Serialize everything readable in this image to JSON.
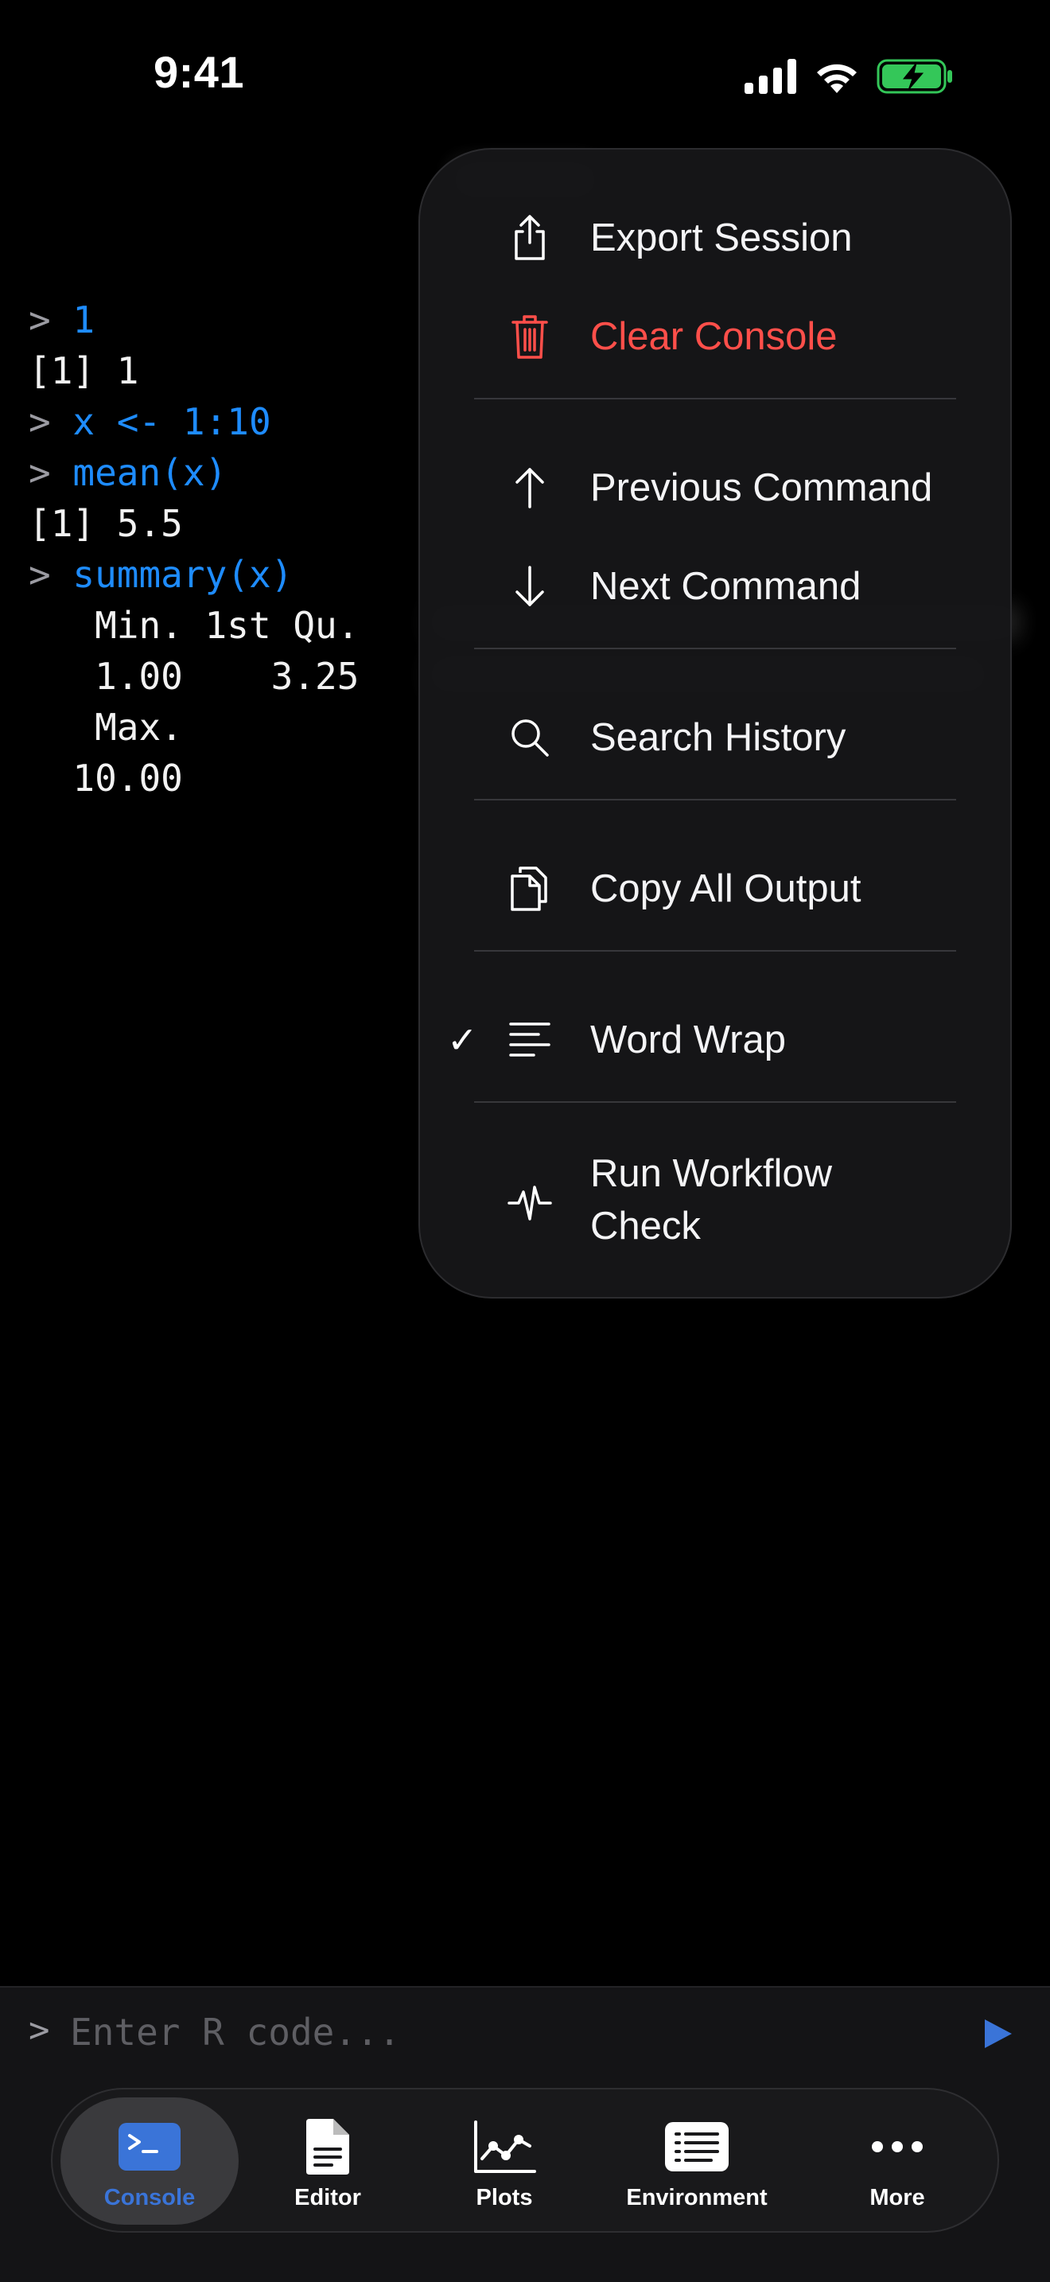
{
  "status": {
    "time": "9:41"
  },
  "console": {
    "lines": [
      {
        "type": "cmd",
        "prompt": ">",
        "text": "1"
      },
      {
        "type": "out",
        "text": "[1] 1"
      },
      {
        "type": "cmd",
        "prompt": ">",
        "text": "x <- 1:10"
      },
      {
        "type": "cmd",
        "prompt": ">",
        "text": "mean(x)"
      },
      {
        "type": "out",
        "text": "[1] 5.5"
      },
      {
        "type": "cmd",
        "prompt": ">",
        "text": "summary(x)"
      },
      {
        "type": "out",
        "text": "   Min. 1st Qu."
      },
      {
        "type": "out",
        "text": "   1.00    3.25"
      },
      {
        "type": "out",
        "text": "   Max."
      },
      {
        "type": "out",
        "text": "  10.00"
      }
    ]
  },
  "menu": {
    "items": [
      {
        "label": "Export Session",
        "icon": "share-icon"
      },
      {
        "label": "Clear Console",
        "icon": "trash-icon",
        "destructive": true
      },
      {
        "label": "Previous Command",
        "icon": "arrow-up-icon"
      },
      {
        "label": "Next Command",
        "icon": "arrow-down-icon"
      },
      {
        "label": "Search History",
        "icon": "search-icon"
      },
      {
        "label": "Copy All Output",
        "icon": "copy-icon"
      },
      {
        "label": "Word Wrap",
        "icon": "text-align-left-icon",
        "checked": true,
        "check": "✓"
      },
      {
        "label_line1": "Run Workflow",
        "label_line2": "Check",
        "icon": "waveform-icon"
      }
    ]
  },
  "input": {
    "prompt": ">",
    "placeholder": "Enter R code...",
    "value": ""
  },
  "tabs": [
    {
      "label": "Console",
      "icon": "terminal-icon",
      "active": true
    },
    {
      "label": "Editor",
      "icon": "document-icon"
    },
    {
      "label": "Plots",
      "icon": "line-chart-icon"
    },
    {
      "label": "Environment",
      "icon": "list-icon"
    },
    {
      "label": "More",
      "icon": "ellipsis-icon"
    }
  ],
  "colors": {
    "accent": "#1e8cff",
    "destructive": "#ff4f4a",
    "tab_active": "#3a74d8",
    "battery": "#34c759"
  }
}
